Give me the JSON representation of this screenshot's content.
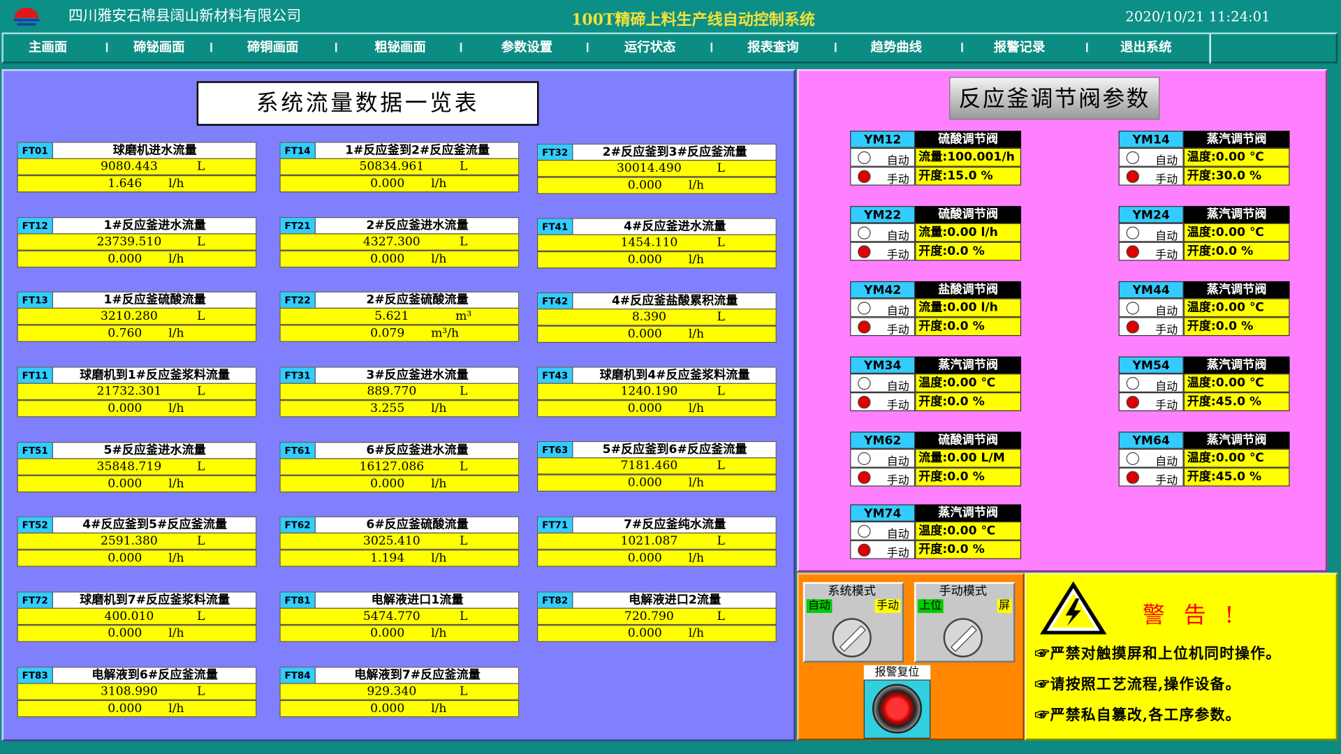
{
  "header": {
    "company": "四川雅安石棉县阔山新材料有限公司",
    "system_title": "100T精碲上料生产线自动控制系统",
    "datetime": "2020/10/21 11:24:01"
  },
  "menu": [
    "主画面",
    "碲铋画面",
    "碲铜画面",
    "粗铋画面",
    "参数设置",
    "运行状态",
    "报表查询",
    "趋势曲线",
    "报警记录",
    "退出系统"
  ],
  "left_title": "系统流量数据一览表",
  "flow_cards": [
    {
      "tag": "FT01",
      "name": "球磨机进水流量",
      "total": "9080.443",
      "total_unit": "L",
      "rate": "1.646",
      "rate_unit": "l/h"
    },
    {
      "tag": "FT12",
      "name": "1#反应釜进水流量",
      "total": "23739.510",
      "total_unit": "L",
      "rate": "0.000",
      "rate_unit": "l/h"
    },
    {
      "tag": "FT13",
      "name": "1#反应釜硫酸流量",
      "total": "3210.280",
      "total_unit": "L",
      "rate": "0.760",
      "rate_unit": "l/h"
    },
    {
      "tag": "FT11",
      "name": "球磨机到1#反应釜浆料流量",
      "total": "21732.301",
      "total_unit": "L",
      "rate": "0.000",
      "rate_unit": "l/h"
    },
    {
      "tag": "FT51",
      "name": "5#反应釜进水流量",
      "total": "35848.719",
      "total_unit": "L",
      "rate": "0.000",
      "rate_unit": "l/h"
    },
    {
      "tag": "FT52",
      "name": "4#反应釜到5#反应釜流量",
      "total": "2591.380",
      "total_unit": "L",
      "rate": "0.000",
      "rate_unit": "l/h"
    },
    {
      "tag": "FT72",
      "name": "球磨机到7#反应釜浆料流量",
      "total": "400.010",
      "total_unit": "L",
      "rate": "0.000",
      "rate_unit": "l/h"
    },
    {
      "tag": "FT83",
      "name": "电解液到6#反应釜流量",
      "total": "3108.990",
      "total_unit": "L",
      "rate": "0.000",
      "rate_unit": "l/h"
    },
    {
      "tag": "FT14",
      "name": "1#反应釜到2#反应釜流量",
      "total": "50834.961",
      "total_unit": "L",
      "rate": "0.000",
      "rate_unit": "l/h"
    },
    {
      "tag": "FT21",
      "name": "2#反应釜进水流量",
      "total": "4327.300",
      "total_unit": "L",
      "rate": "0.000",
      "rate_unit": "l/h"
    },
    {
      "tag": "FT22",
      "name": "2#反应釜硫酸流量",
      "total": "5.621",
      "total_unit": "m³",
      "rate": "0.079",
      "rate_unit": "m³/h"
    },
    {
      "tag": "FT31",
      "name": "3#反应釜进水流量",
      "total": "889.770",
      "total_unit": "L",
      "rate": "3.255",
      "rate_unit": "l/h"
    },
    {
      "tag": "FT61",
      "name": "6#反应釜进水流量",
      "total": "16127.086",
      "total_unit": "L",
      "rate": "0.000",
      "rate_unit": "l/h"
    },
    {
      "tag": "FT62",
      "name": "6#反应釜硫酸流量",
      "total": "3025.410",
      "total_unit": "L",
      "rate": "1.194",
      "rate_unit": "l/h"
    },
    {
      "tag": "FT81",
      "name": "电解液进口1流量",
      "total": "5474.770",
      "total_unit": "L",
      "rate": "0.000",
      "rate_unit": "l/h"
    },
    {
      "tag": "FT84",
      "name": "电解液到7#反应釜流量",
      "total": "929.340",
      "total_unit": "L",
      "rate": "0.000",
      "rate_unit": "l/h"
    },
    {
      "tag": "FT32",
      "name": "2#反应釜到3#反应釜流量",
      "total": "30014.490",
      "total_unit": "L",
      "rate": "0.000",
      "rate_unit": "l/h"
    },
    {
      "tag": "FT41",
      "name": "4#反应釜进水流量",
      "total": "1454.110",
      "total_unit": "L",
      "rate": "0.000",
      "rate_unit": "l/h"
    },
    {
      "tag": "FT42",
      "name": "4#反应釜盐酸累积流量",
      "total": "8.390",
      "total_unit": "L",
      "rate": "0.000",
      "rate_unit": "l/h"
    },
    {
      "tag": "FT43",
      "name": "球磨机到4#反应釜浆料流量",
      "total": "1240.190",
      "total_unit": "L",
      "rate": "0.000",
      "rate_unit": "l/h"
    },
    {
      "tag": "FT63",
      "name": "5#反应釜到6#反应釜流量",
      "total": "7181.460",
      "total_unit": "L",
      "rate": "0.000",
      "rate_unit": "l/h"
    },
    {
      "tag": "FT71",
      "name": "7#反应釜纯水流量",
      "total": "1021.087",
      "total_unit": "L",
      "rate": "0.000",
      "rate_unit": "l/h"
    },
    {
      "tag": "FT82",
      "name": "电解液进口2流量",
      "total": "720.790",
      "total_unit": "L",
      "rate": "0.000",
      "rate_unit": "l/h"
    }
  ],
  "right_title": "反应釜调节阀参数",
  "valves": [
    {
      "id": "YM12",
      "name": "硫酸调节阀",
      "auto": "自动",
      "manual": "手动",
      "line1": "流量:100.001/h",
      "line2": "开度:15.0  %"
    },
    {
      "id": "YM22",
      "name": "硫酸调节阀",
      "auto": "自动",
      "manual": "手动",
      "line1": "流量:0.00 l/h",
      "line2": "开度:0.0   %"
    },
    {
      "id": "YM42",
      "name": "盐酸调节阀",
      "auto": "自动",
      "manual": "手动",
      "line1": "流量:0.00 l/h",
      "line2": "开度:0.0   %"
    },
    {
      "id": "YM34",
      "name": "蒸汽调节阀",
      "auto": "自动",
      "manual": "手动",
      "line1": "温度:0.00 ℃",
      "line2": "开度:0.0   %"
    },
    {
      "id": "YM62",
      "name": "硫酸调节阀",
      "auto": "自动",
      "manual": "手动",
      "line1": "流量:0.00 L/M",
      "line2": "开度:0.0   %"
    },
    {
      "id": "YM74",
      "name": "蒸汽调节阀",
      "auto": "自动",
      "manual": "手动",
      "line1": "温度:0.00 ℃",
      "line2": "开度:0.0   %"
    },
    {
      "id": "YM14",
      "name": "蒸汽调节阀",
      "auto": "自动",
      "manual": "手动",
      "line1": "温度:0.00 ℃",
      "line2": "开度:30.0  %"
    },
    {
      "id": "YM24",
      "name": "蒸汽调节阀",
      "auto": "自动",
      "manual": "手动",
      "line1": "温度:0.00 ℃",
      "line2": "开度:0.0   %"
    },
    {
      "id": "YM44",
      "name": "蒸汽调节阀",
      "auto": "自动",
      "manual": "手动",
      "line1": "温度:0.00 ℃",
      "line2": "开度:0.0   %"
    },
    {
      "id": "YM54",
      "name": "蒸汽调节阀",
      "auto": "自动",
      "manual": "手动",
      "line1": "温度:0.00 ℃",
      "line2": "开度:45.0  %"
    },
    {
      "id": "YM64",
      "name": "蒸汽调节阀",
      "auto": "自动",
      "manual": "手动",
      "line1": "温度:0.00 ℃",
      "line2": "开度:45.0  %"
    }
  ],
  "controls": {
    "system_mode_title": "系统模式",
    "system_mode_left": "自动",
    "system_mode_right": "手动",
    "manual_mode_title": "手动模式",
    "manual_mode_left": "上位",
    "manual_mode_right": "屏",
    "reset_label": "报警复位"
  },
  "warning": {
    "title": "警告!",
    "lines": [
      "☞严禁对触摸屏和上位机同时操作。",
      "☞请按照工艺流程,操作设备。",
      "☞严禁私自篡改,各工序参数。"
    ]
  },
  "colors": {
    "background": "#0e8a82",
    "left_panel": "#8080ff",
    "right_panel": "#ff80ff",
    "tag_bg": "#33ccff",
    "value_bg": "#ffff00",
    "control_panel": "#ff8800",
    "warning_panel": "#ffff00"
  },
  "icons": {
    "logo": "company-logo",
    "warning": "high-voltage-warning-icon",
    "reset": "red-reset-button"
  }
}
